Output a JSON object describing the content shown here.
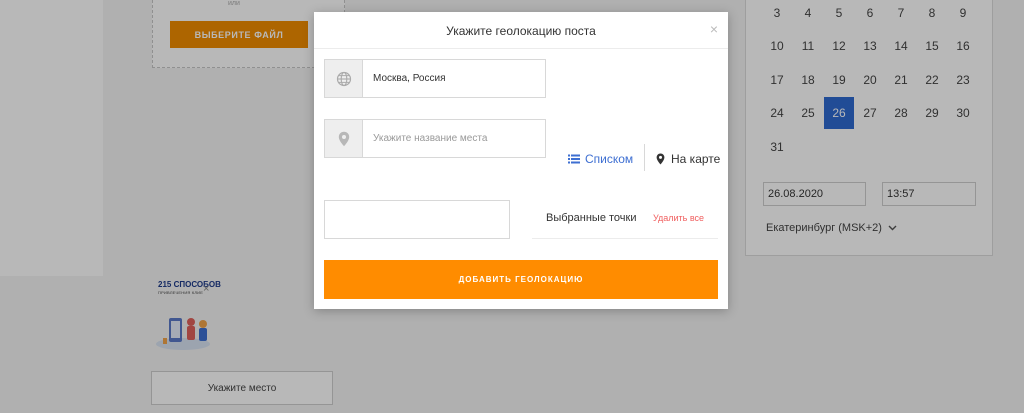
{
  "background": {
    "upload": {
      "hint_label": "или",
      "choose_file_label": "ВЫБЕРИТЕ ФАЙЛ"
    },
    "thumbnail": {
      "title": "215 СПОСОБОВ",
      "subtitle": "ПРИВЛЕЧЕНИЯ КЛИЕ"
    },
    "place_button_label": "Укажите место",
    "calendar": {
      "days": [
        "3",
        "4",
        "5",
        "6",
        "7",
        "8",
        "9",
        "10",
        "11",
        "12",
        "13",
        "14",
        "15",
        "16",
        "17",
        "18",
        "19",
        "20",
        "21",
        "22",
        "23",
        "24",
        "25",
        "26",
        "27",
        "28",
        "29",
        "30",
        "31"
      ],
      "selected_day": "26",
      "date_value": "26.08.2020",
      "time_value": "13:57",
      "timezone_label": "Екатеринбург (MSK+2)"
    }
  },
  "modal": {
    "title": "Укажите геолокацию поста",
    "close_label": "×",
    "city_value": "Москва, Россия",
    "place_placeholder": "Укажите название места",
    "view_list_label": "Списком",
    "view_map_label": "На карте",
    "selected_points_label": "Выбранные точки",
    "delete_all_label": "Удалить все",
    "add_button_label": "ДОБАВИТЬ ГЕОЛОКАЦИЮ"
  },
  "colors": {
    "accent": "#ff8c00",
    "link": "#3e6fd2",
    "danger": "#f06060",
    "calendar_selected": "#2f6ad0"
  }
}
